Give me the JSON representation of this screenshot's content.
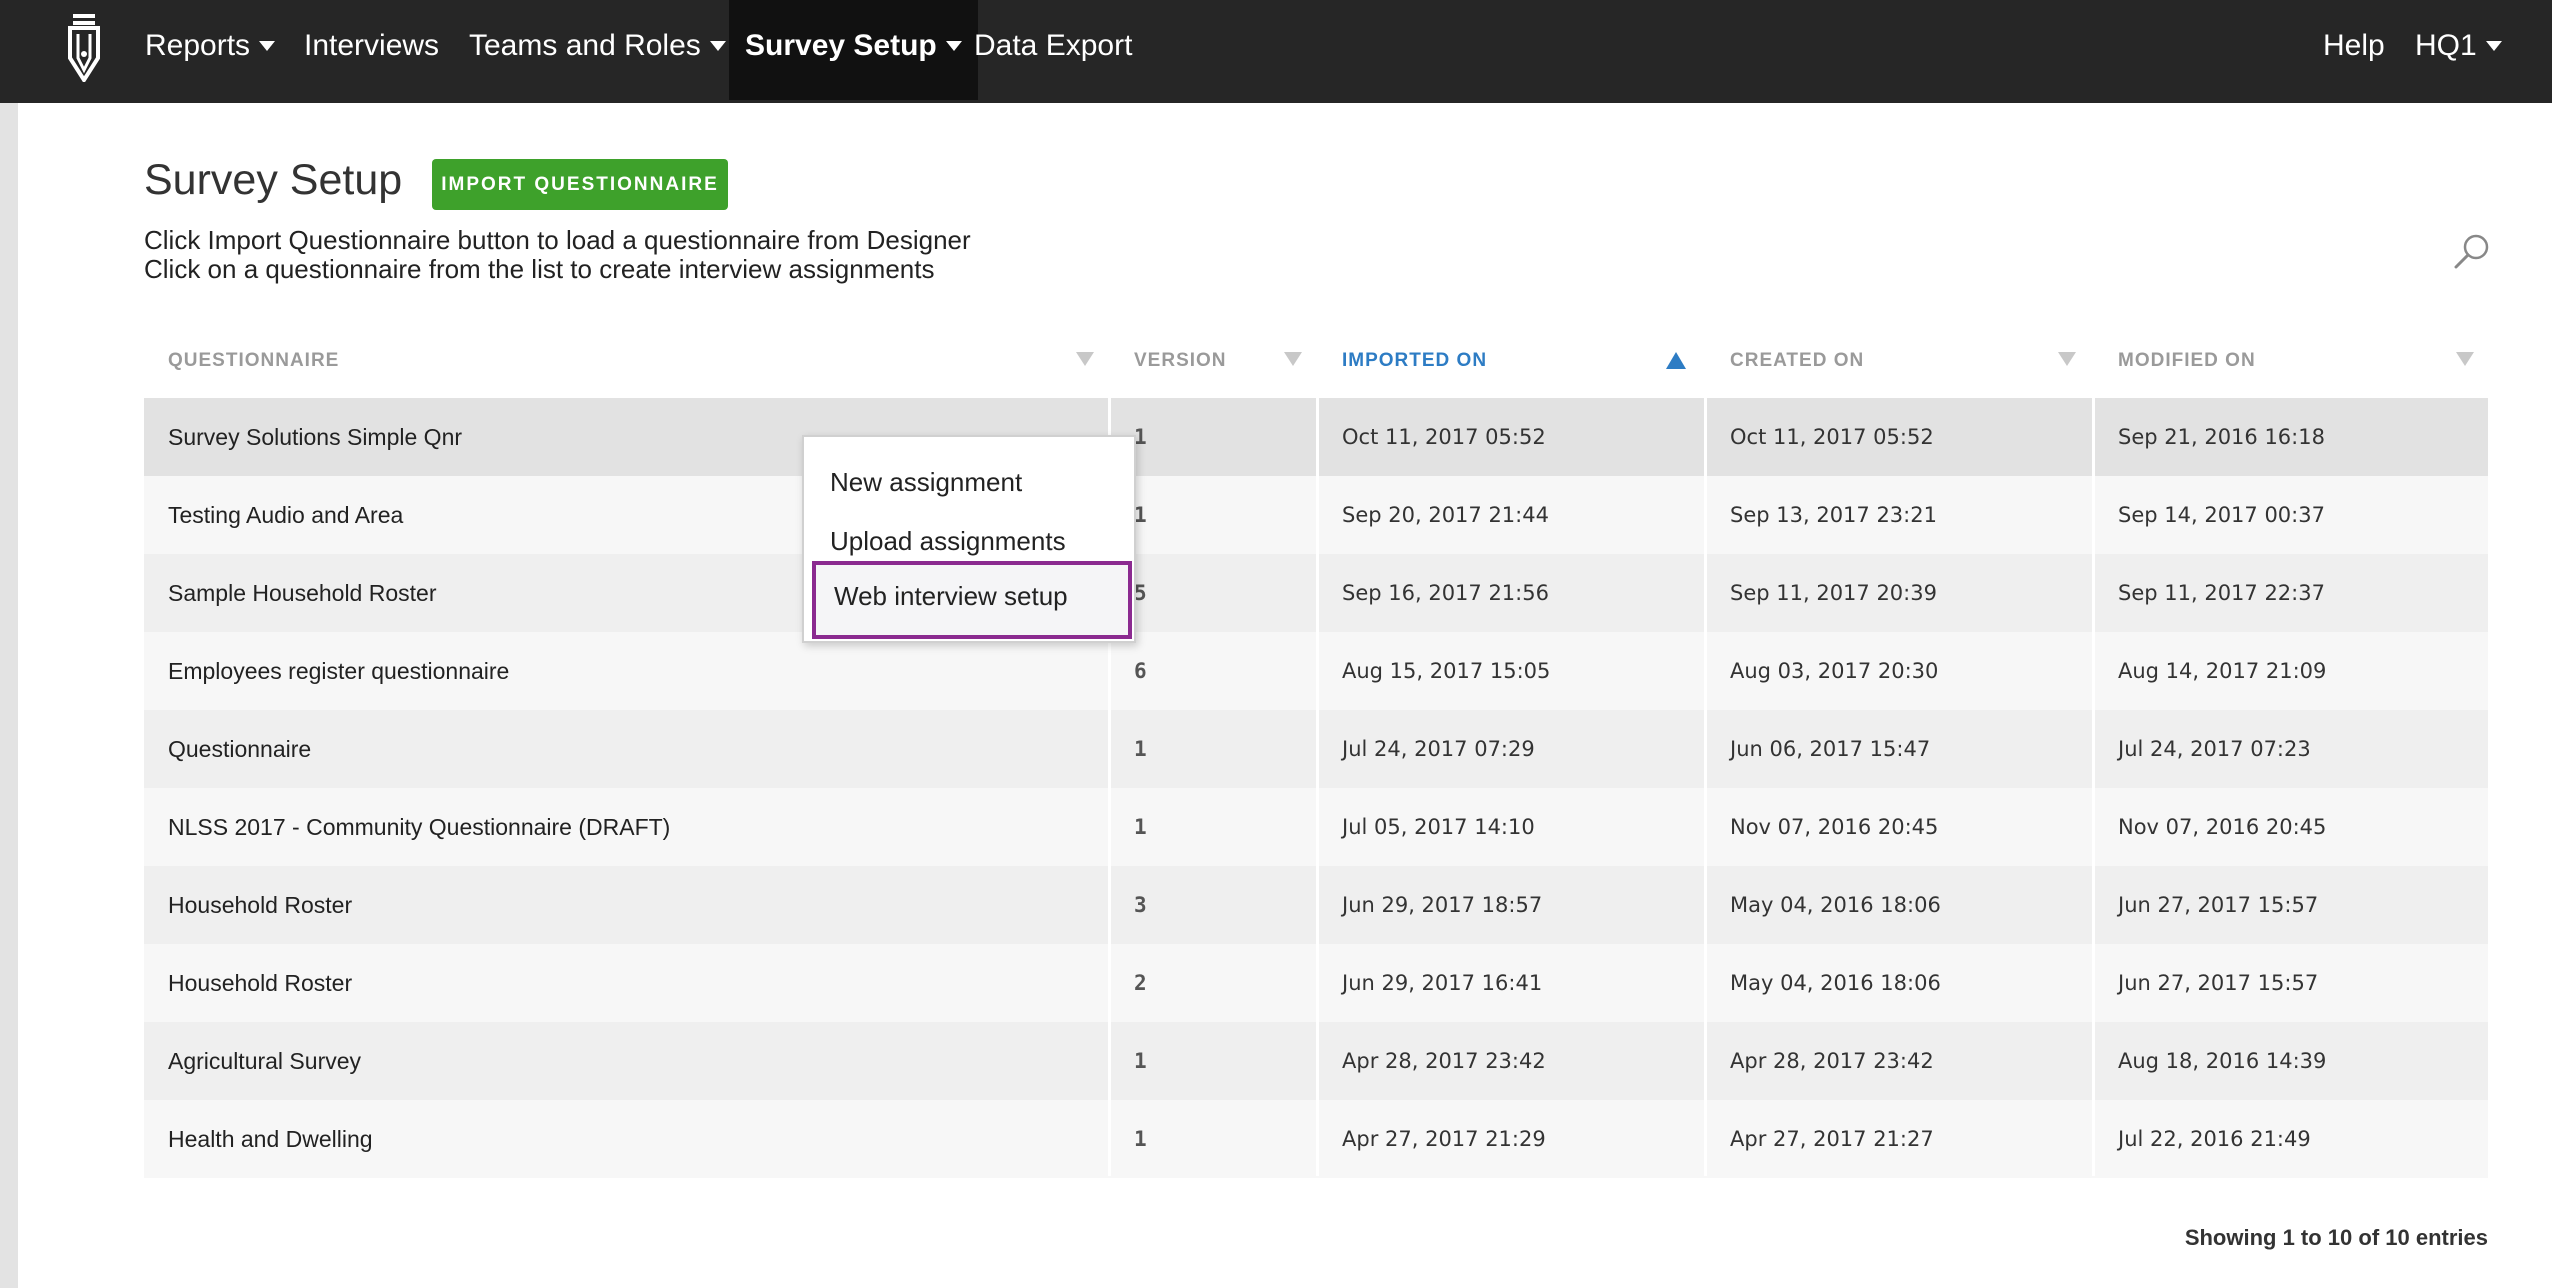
{
  "nav": {
    "reports": "Reports",
    "interviews": "Interviews",
    "teams": "Teams and Roles",
    "survey_setup": "Survey Setup",
    "data_export": "Data Export",
    "help": "Help",
    "user": "HQ1"
  },
  "header": {
    "title": "Survey Setup",
    "import_button": "IMPORT QUESTIONNAIRE",
    "instruction_1": "Click Import Questionnaire button to load a questionnaire from Designer",
    "instruction_2": "Click on a questionnaire from the list to create interview assignments"
  },
  "table": {
    "columns": [
      "QUESTIONNAIRE",
      "VERSION",
      "IMPORTED ON",
      "CREATED ON",
      "MODIFIED ON"
    ],
    "sorted_column": "IMPORTED ON",
    "rows": [
      [
        "Survey Solutions Simple Qnr",
        "1",
        "Oct 11, 2017 05:52",
        "Oct 11, 2017 05:52",
        "Sep 21, 2016 16:18"
      ],
      [
        "Testing Audio and Area",
        "1",
        "Sep 20, 2017 21:44",
        "Sep 13, 2017 23:21",
        "Sep 14, 2017 00:37"
      ],
      [
        "Sample Household Roster",
        "5",
        "Sep 16, 2017 21:56",
        "Sep 11, 2017 20:39",
        "Sep 11, 2017 22:37"
      ],
      [
        "Employees register questionnaire",
        "6",
        "Aug 15, 2017 15:05",
        "Aug 03, 2017 20:30",
        "Aug 14, 2017 21:09"
      ],
      [
        "Questionnaire",
        "1",
        "Jul 24, 2017 07:29",
        "Jun 06, 2017 15:47",
        "Jul 24, 2017 07:23"
      ],
      [
        "NLSS 2017 - Community Questionnaire (DRAFT)",
        "1",
        "Jul 05, 2017 14:10",
        "Nov 07, 2016 20:45",
        "Nov 07, 2016 20:45"
      ],
      [
        "Household Roster",
        "3",
        "Jun 29, 2017 18:57",
        "May 04, 2016 18:06",
        "Jun 27, 2017 15:57"
      ],
      [
        "Household Roster",
        "2",
        "Jun 29, 2017 16:41",
        "May 04, 2016 18:06",
        "Jun 27, 2017 15:57"
      ],
      [
        "Agricultural Survey",
        "1",
        "Apr 28, 2017 23:42",
        "Apr 28, 2017 23:42",
        "Aug 18, 2016 14:39"
      ],
      [
        "Health and Dwelling",
        "1",
        "Apr 27, 2017 21:29",
        "Apr 27, 2017 21:27",
        "Jul 22, 2016 21:49"
      ]
    ]
  },
  "context_menu": {
    "items": [
      "New assignment",
      "Upload assignments",
      "Web interview setup"
    ],
    "highlighted": "Web interview setup"
  },
  "footer": {
    "info": "Showing 1 to 10 of 10 entries"
  },
  "colors": {
    "navbar": "#262626",
    "accent_green": "#3ea12b",
    "sort_blue": "#2d7cc4",
    "highlight_purple": "#8b2a90"
  }
}
